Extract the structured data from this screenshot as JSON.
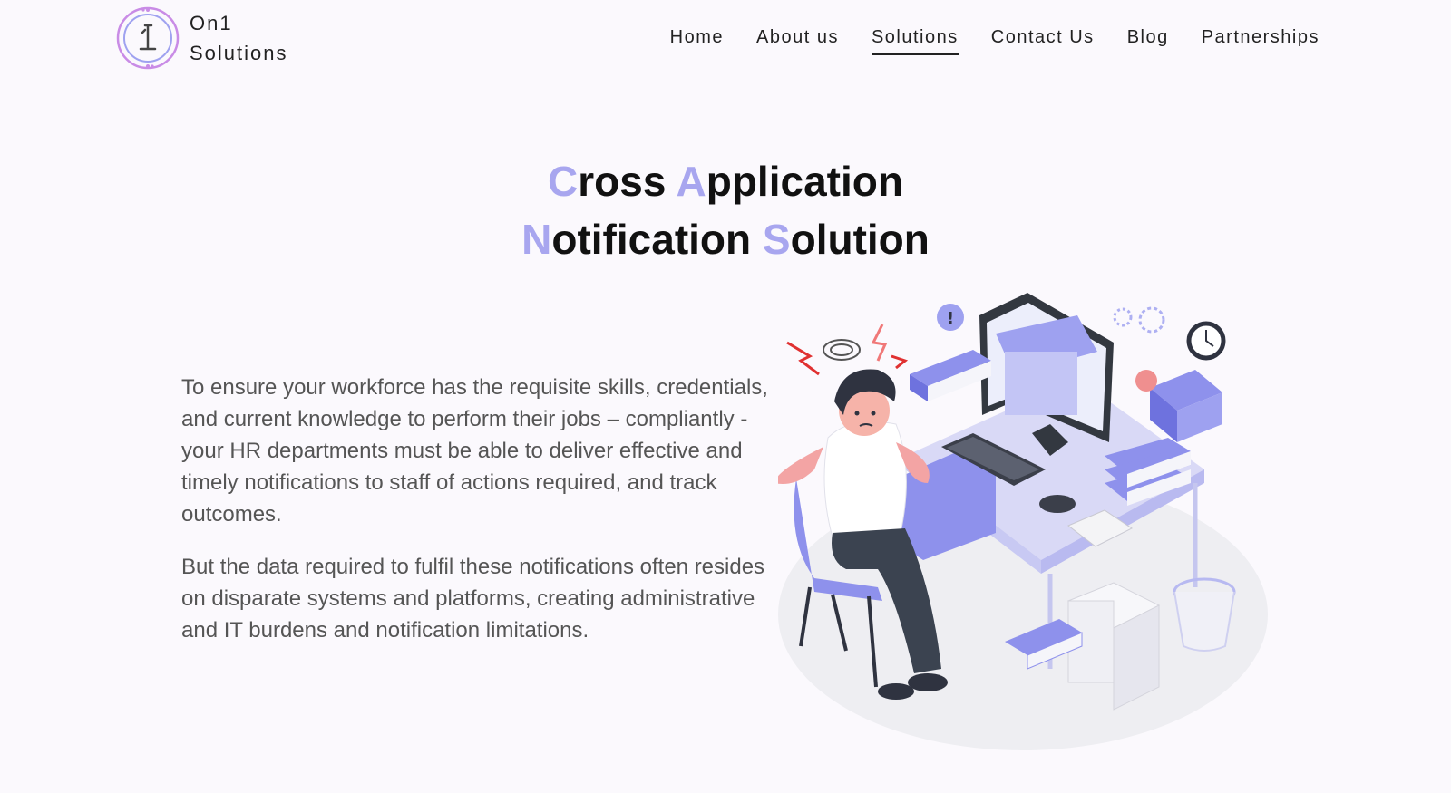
{
  "brand": {
    "line1": "On1",
    "line2": "Solutions"
  },
  "nav": {
    "items": [
      {
        "label": "Home"
      },
      {
        "label": "About us"
      },
      {
        "label": "Solutions"
      },
      {
        "label": "Contact Us"
      },
      {
        "label": "Blog"
      },
      {
        "label": "Partnerships"
      }
    ],
    "active": "Solutions"
  },
  "hero": {
    "title_line1": [
      {
        "initial": "C",
        "rest": "ross "
      },
      {
        "initial": "A",
        "rest": "pplication"
      }
    ],
    "title_line2": [
      {
        "initial": "N",
        "rest": "otification "
      },
      {
        "initial": "S",
        "rest": "olution"
      }
    ],
    "paragraph1": "To ensure your workforce has the requisite skills, credentials, and current knowledge to perform their jobs – compliantly - your HR departments must be able to deliver effective and timely notifications to staff of actions required, and track outcomes.",
    "paragraph2": "But the data required to fulfil these notifications often resides on disparate systems and platforms, creating administrative and IT burdens and notification limitations."
  },
  "colors": {
    "accent": "#a8a6ef",
    "illustration_primary": "#7b7fe8",
    "background": "#fbf9fd"
  }
}
